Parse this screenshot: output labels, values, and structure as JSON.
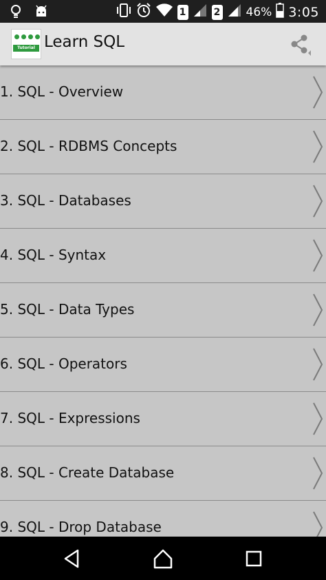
{
  "status_bar": {
    "sim1": "1",
    "sim2": "2",
    "battery": "46%",
    "time": "3:05",
    "icons": [
      "bulb-icon",
      "android-icon",
      "vibrate-icon",
      "alarm-icon",
      "wifi-icon",
      "signal-icon",
      "battery-icon"
    ]
  },
  "app_bar": {
    "title": "Learn SQL",
    "logo_text": "Tutorial",
    "share_icon": "share-icon"
  },
  "menu": {
    "items": [
      {
        "label": "1. SQL - Overview"
      },
      {
        "label": "2. SQL - RDBMS Concepts"
      },
      {
        "label": "3. SQL - Databases"
      },
      {
        "label": "4. SQL - Syntax"
      },
      {
        "label": "5. SQL - Data Types"
      },
      {
        "label": "6. SQL - Operators"
      },
      {
        "label": "7. SQL - Expressions"
      },
      {
        "label": "8. SQL - Create Database"
      },
      {
        "label": "9. SQL - Drop Database"
      }
    ]
  },
  "nav_bar": {
    "icons": [
      "back-icon",
      "home-icon",
      "recents-icon"
    ]
  },
  "colors": {
    "list_bg": "#c6c6c6",
    "divider": "#8a8a8a",
    "app_bar_bg": "#e3e3e3",
    "logo_green": "#2e9a3e"
  }
}
